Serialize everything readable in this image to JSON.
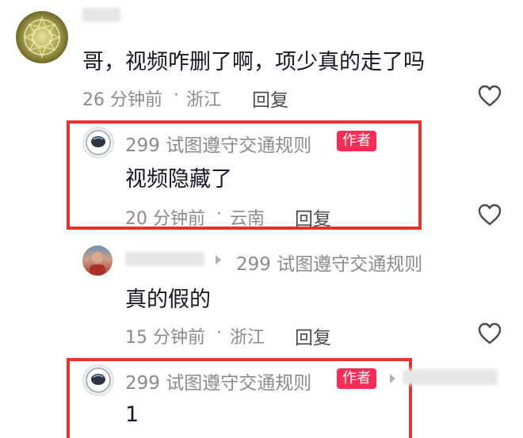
{
  "comments": [
    {
      "content": "哥，视频咋删了啊，项少真的走了吗",
      "time": "26 分钟前",
      "separator": "·",
      "location": "浙江",
      "reply_label": "回复"
    },
    {
      "author": "299 试图遵守交通规则",
      "badge": "作者",
      "content": "视频隐藏了",
      "time": "20 分钟前",
      "separator": "·",
      "location": "云南",
      "reply_label": "回复"
    },
    {
      "reply_to": "299 试图遵守交通规则",
      "content": "真的假的",
      "time": "15 分钟前",
      "separator": "·",
      "location": "浙江",
      "reply_label": "回复"
    },
    {
      "author": "299 试图遵守交通规则",
      "badge": "作者",
      "content": "1"
    }
  ],
  "colors": {
    "highlight": "#e8322d",
    "badge": "#fe2c55",
    "meta_text": "#8a8a8f"
  },
  "icons": {
    "like": "heart-outline-icon",
    "reply_arrow": "caret-right-icon"
  }
}
